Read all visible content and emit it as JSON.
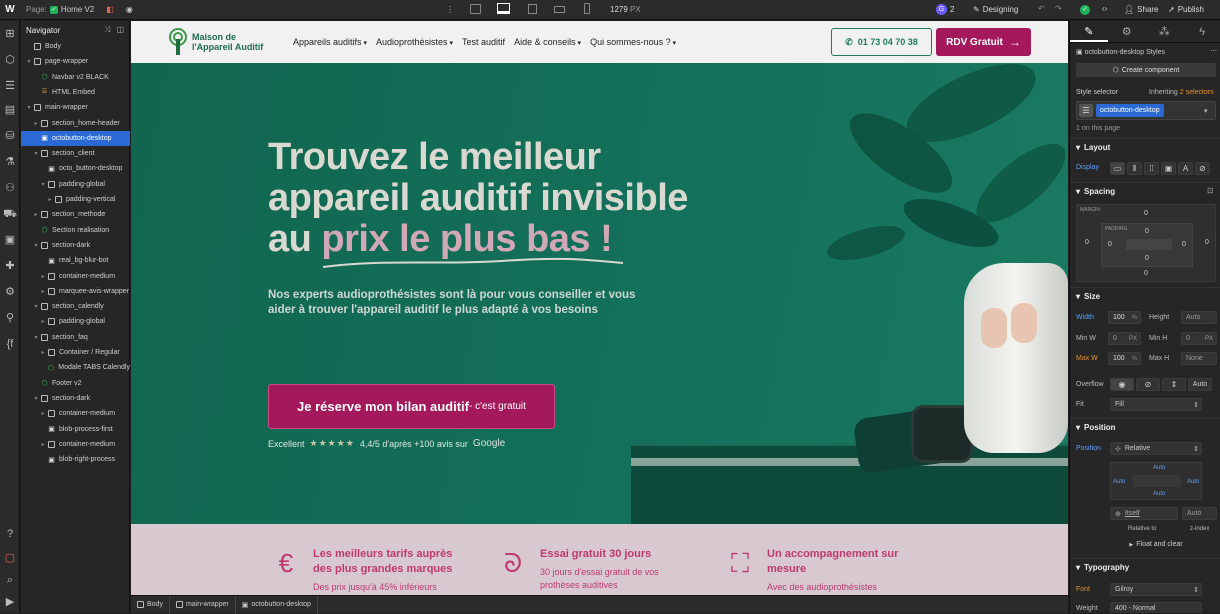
{
  "topbar": {
    "page_label": "Page:",
    "page_name": "Home V2",
    "width_value": "1279",
    "width_unit": "PX",
    "collab_count": "2",
    "mode": "Designing",
    "share": "Share",
    "publish": "Publish"
  },
  "navigator": {
    "title": "Navigator",
    "items": [
      {
        "label": "Body",
        "depth": 0,
        "caret": "",
        "icon": "box"
      },
      {
        "label": "page-wrapper",
        "depth": 0,
        "caret": "▾",
        "icon": "box"
      },
      {
        "label": "Navbar v2 BLACK",
        "depth": 1,
        "caret": "",
        "icon": "component"
      },
      {
        "label": "HTML Embed",
        "depth": 1,
        "caret": "",
        "icon": "embed"
      },
      {
        "label": "main-wrapper",
        "depth": 0,
        "caret": "▾",
        "icon": "box"
      },
      {
        "label": "section_home-header",
        "depth": 1,
        "caret": "▸",
        "icon": "box"
      },
      {
        "label": "octobutton-desktop",
        "depth": 1,
        "caret": "",
        "icon": "image",
        "selected": true
      },
      {
        "label": "section_client",
        "depth": 1,
        "caret": "▾",
        "icon": "box"
      },
      {
        "label": "octo_button-desktop",
        "depth": 2,
        "caret": "",
        "icon": "image"
      },
      {
        "label": "padding-global",
        "depth": 2,
        "caret": "▾",
        "icon": "box"
      },
      {
        "label": "padding-vertical",
        "depth": 3,
        "caret": "▸",
        "icon": "box"
      },
      {
        "label": "section_methode",
        "depth": 1,
        "caret": "▸",
        "icon": "box"
      },
      {
        "label": "Section realisation",
        "depth": 1,
        "caret": "",
        "icon": "component"
      },
      {
        "label": "section-dark",
        "depth": 1,
        "caret": "▾",
        "icon": "box"
      },
      {
        "label": "real_bg-blur-bot",
        "depth": 2,
        "caret": "",
        "icon": "image"
      },
      {
        "label": "container-medium",
        "depth": 2,
        "caret": "▸",
        "icon": "box"
      },
      {
        "label": "marquee-avis-wrapper",
        "depth": 2,
        "caret": "▸",
        "icon": "box"
      },
      {
        "label": "section_calendly",
        "depth": 1,
        "caret": "▾",
        "icon": "box"
      },
      {
        "label": "padding-global",
        "depth": 2,
        "caret": "▸",
        "icon": "box"
      },
      {
        "label": "section_faq",
        "depth": 1,
        "caret": "▾",
        "icon": "box"
      },
      {
        "label": "Container / Regular",
        "depth": 2,
        "caret": "▸",
        "icon": "box"
      },
      {
        "label": "Modale TABS Calendly",
        "depth": 2,
        "caret": "",
        "icon": "component"
      },
      {
        "label": "Footer v2",
        "depth": 1,
        "caret": "",
        "icon": "component"
      },
      {
        "label": "section-dark",
        "depth": 1,
        "caret": "▾",
        "icon": "box"
      },
      {
        "label": "container-medium",
        "depth": 2,
        "caret": "▸",
        "icon": "box"
      },
      {
        "label": "blob-process-first",
        "depth": 2,
        "caret": "",
        "icon": "image"
      },
      {
        "label": "container-medium",
        "depth": 2,
        "caret": "▸",
        "icon": "box"
      },
      {
        "label": "blob-right-process",
        "depth": 2,
        "caret": "",
        "icon": "image"
      }
    ]
  },
  "site": {
    "logo_line1": "Maison de",
    "logo_line2": "l'Appareil Auditif",
    "menu": [
      "Appareils auditifs",
      "Audioprothésistes",
      "Test auditif",
      "Aide & conseils",
      "Qui sommes-nous ?"
    ],
    "menu_has_caret": [
      true,
      true,
      false,
      true,
      true
    ],
    "phone": "01 73 04 70 38",
    "rdv": "RDV Gratuit",
    "hero_line1": "Trouvez le meilleur",
    "hero_line2": "appareil auditif invisible",
    "hero_line3_a": "au ",
    "hero_line3_b": "prix le plus bas !",
    "subtitle_line1": "Nos experts audioprothésistes sont là pour vous conseiller et vous",
    "subtitle_line2": "aider à trouver l'appareil auditif le plus adapté à vos besoins",
    "cta_main": "Je réserve mon bilan auditif",
    "cta_suffix": " - c'est gratuit",
    "rating_prefix": "Excellent",
    "stars": "★★★★★",
    "rating_text": "4,4/5 d'après +100 avis sur",
    "google": "Google",
    "features": [
      {
        "icon": "euro-icon",
        "title_l1": "Les meilleurs tarifs auprès",
        "title_l2": "des plus grandes marques",
        "desc": "Des prix jusqu'à 45% inférieurs",
        "desc2": ""
      },
      {
        "icon": "ear-icon",
        "title_l1": "Essai gratuit 30 jours",
        "title_l2": "",
        "desc": "30 jours d'essai gratuit de vos",
        "desc2": "prothèses auditives"
      },
      {
        "icon": "user-focus-icon",
        "title_l1": "Un accompagnement sur",
        "title_l2": "mesure",
        "desc": "Avec des audioprothésistes",
        "desc2": ""
      }
    ]
  },
  "breadcrumb": [
    "Body",
    "main-wrapper",
    "octobutton-desktop"
  ],
  "style_panel": {
    "element_styles": "octobutton-desktop Styles",
    "create_component": "Create component",
    "style_selector": "Style selector",
    "inheriting": "Inheriting",
    "selectors_count": "2 selectors",
    "selector_chip": "octobutton-desktop",
    "on_page": "1 on this page",
    "layout": "Layout",
    "display": "Display",
    "spacing": "Spacing",
    "margin": "MARGIN",
    "padding": "PADDING",
    "zero": "0",
    "size": "Size",
    "width": "Width",
    "width_val": "100",
    "width_unit": "%",
    "height": "Height",
    "auto": "Auto",
    "min_w": "Min W",
    "min_w_val": "0",
    "px": "PX",
    "min_h": "Min H",
    "min_h_val": "0",
    "max_w": "Max W",
    "max_w_val": "100",
    "max_h": "Max H",
    "none": "None",
    "overflow": "Overflow",
    "overflow_auto": "Auto",
    "fit": "Fit",
    "fit_val": "Fill",
    "position": "Position",
    "position_label": "Position",
    "position_val": "Relative",
    "itself": "Itself",
    "relative_to": "Relative to",
    "z_index": "z-index",
    "float_clear": "Float and clear",
    "typography": "Typography",
    "font": "Font",
    "font_val": "Gilroy",
    "weight": "Weight",
    "weight_val": "400 - Normal"
  },
  "colors": {
    "hero_green": "#13705a",
    "accent_pink": "#a3195b",
    "selection_blue": "#2b6ad4",
    "feature_pink": "#c0386f"
  }
}
